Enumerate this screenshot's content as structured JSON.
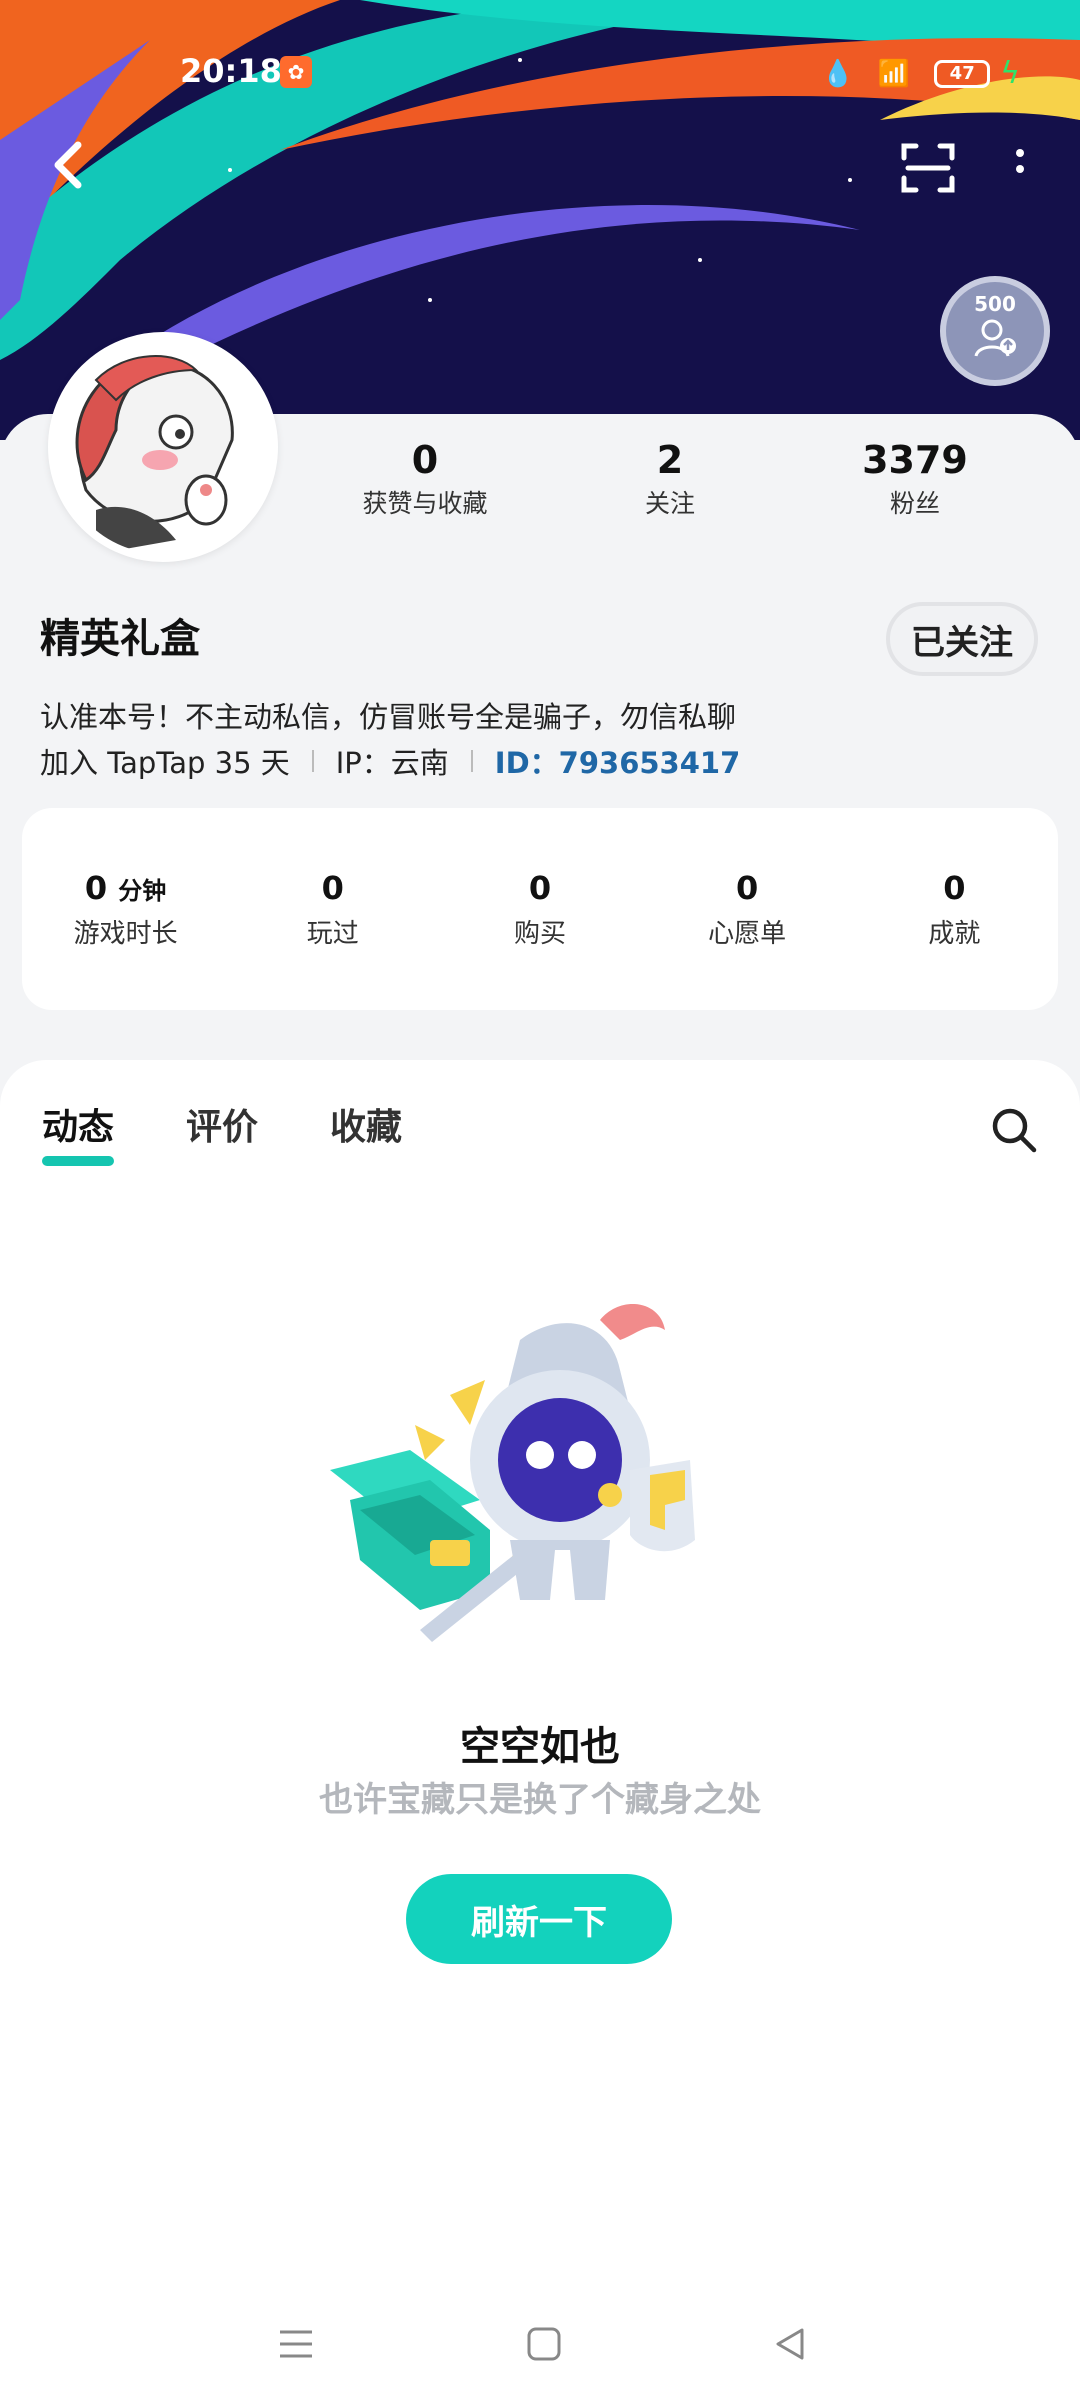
{
  "status_bar": {
    "time": "20:18",
    "battery": "47"
  },
  "profile": {
    "level_badge": "500",
    "stats": [
      {
        "value": "0",
        "label": "获赞与收藏"
      },
      {
        "value": "2",
        "label": "关注"
      },
      {
        "value": "3379",
        "label": "粉丝"
      }
    ],
    "name": "精英礼盒",
    "follow_button": "已关注",
    "bio": "认准本号！不主动私信，仿冒账号全是骗子，勿信私聊",
    "joined": "加入 TapTap 35 天",
    "ip": "IP：云南",
    "id": "ID：793653417"
  },
  "game_stats": [
    {
      "value": "0",
      "unit": "分钟",
      "label": "游戏时长"
    },
    {
      "value": "0",
      "label": "玩过"
    },
    {
      "value": "0",
      "label": "购买"
    },
    {
      "value": "0",
      "label": "心愿单"
    },
    {
      "value": "0",
      "label": "成就"
    }
  ],
  "tabs": [
    "动态",
    "评价",
    "收藏"
  ],
  "empty_state": {
    "title": "空空如也",
    "subtitle": "也许宝藏只是换了个藏身之处",
    "button": "刷新一下"
  },
  "colors": {
    "accent": "#13d2bd",
    "id_link": "#1f67a6"
  },
  "icons": [
    "back-arrow-icon",
    "scan-icon",
    "more-icon",
    "search-icon",
    "menu-icon",
    "home-icon",
    "back-icon"
  ]
}
